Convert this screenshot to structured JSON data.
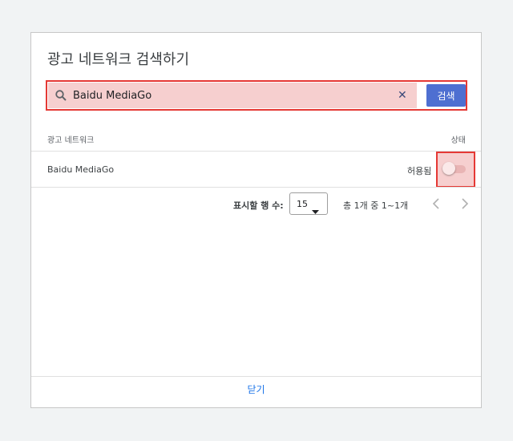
{
  "dialog": {
    "title": "광고 네트워크 검색하기",
    "search": {
      "value": "Baidu MediaGo",
      "button_label": "검색"
    },
    "table": {
      "headers": {
        "network": "광고 네트워크",
        "status": "상태"
      },
      "rows": [
        {
          "name": "Baidu MediaGo",
          "status": "허용됨",
          "toggle_on": false
        }
      ]
    },
    "pagination": {
      "rows_label": "표시할 행 수:",
      "rows_value": "15",
      "info": "총 1개 중 1~1개"
    },
    "close_label": "닫기"
  },
  "colors": {
    "accent": "#4e6fd1",
    "highlight_border": "#e53935",
    "highlight_fill": "#f6cfcf",
    "link": "#1a73e8"
  }
}
